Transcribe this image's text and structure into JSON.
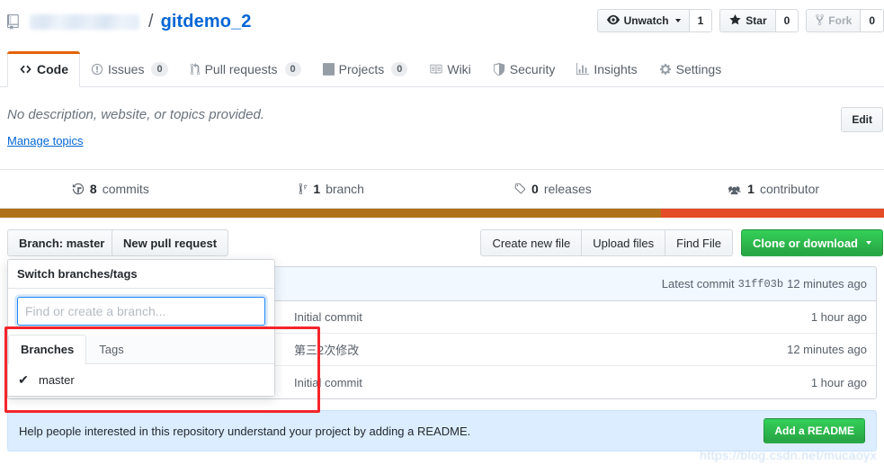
{
  "header": {
    "repo_icon": "repo-book-icon",
    "owner": "",
    "separator": "/",
    "repo_name": "gitdemo_2",
    "actions": [
      {
        "icon": "eye-icon",
        "label": "Unwatch",
        "count": "1",
        "has_caret": true,
        "disabled": false
      },
      {
        "icon": "star-icon",
        "label": "Star",
        "count": "0",
        "has_caret": false,
        "disabled": false
      },
      {
        "icon": "fork-icon",
        "label": "Fork",
        "count": "0",
        "has_caret": false,
        "disabled": true
      }
    ]
  },
  "nav": {
    "items": [
      {
        "icon": "code-icon",
        "label": "Code",
        "count": null,
        "selected": true
      },
      {
        "icon": "issue-opened-icon",
        "label": "Issues",
        "count": "0",
        "selected": false
      },
      {
        "icon": "git-pull-request-icon",
        "label": "Pull requests",
        "count": "0",
        "selected": false
      },
      {
        "icon": "project-board-icon",
        "label": "Projects",
        "count": "0",
        "selected": false
      },
      {
        "icon": "book-icon",
        "label": "Wiki",
        "count": null,
        "selected": false
      },
      {
        "icon": "shield-icon",
        "label": "Security",
        "count": null,
        "selected": false
      },
      {
        "icon": "graph-icon",
        "label": "Insights",
        "count": null,
        "selected": false
      },
      {
        "icon": "gear-icon",
        "label": "Settings",
        "count": null,
        "selected": false
      }
    ]
  },
  "about": {
    "description": "No description, website, or topics provided.",
    "manage_topics_label": "Manage topics",
    "edit_label": "Edit"
  },
  "stats": [
    {
      "icon": "history-icon",
      "value": "8",
      "label": "commits"
    },
    {
      "icon": "git-branch-icon",
      "value": "1",
      "label": "branch"
    },
    {
      "icon": "tag-icon",
      "value": "0",
      "label": "releases"
    },
    {
      "icon": "people-icon",
      "value": "1",
      "label": "contributor"
    }
  ],
  "language_bar": [
    {
      "color": "#b07219",
      "percent": 74.8
    },
    {
      "color": "#e34c26",
      "percent": 25.2
    }
  ],
  "toolbar": {
    "branch_button_label": "Branch: master",
    "new_pull_request_label": "New pull request",
    "create_new_file_label": "Create new file",
    "upload_files_label": "Upload files",
    "find_file_label": "Find File",
    "clone_label": "Clone or download"
  },
  "branch_dropdown": {
    "header": "Switch branches/tags",
    "search_placeholder": "Find or create a branch...",
    "search_value": "",
    "tabs": [
      {
        "label": "Branches",
        "active": true
      },
      {
        "label": "Tags",
        "active": false
      }
    ],
    "items": [
      {
        "label": "master",
        "selected": true,
        "check": "✔"
      }
    ]
  },
  "files": {
    "commit_bar": {
      "latest_commit_label": "Latest commit",
      "sha": "31ff03b",
      "age": "12 minutes ago"
    },
    "rows": [
      {
        "icon": "file-icon",
        "name": "",
        "message": "Initial commit",
        "age": "1 hour ago"
      },
      {
        "icon": "file-icon",
        "name": "",
        "message": "第三2次修改",
        "age": "12 minutes ago"
      },
      {
        "icon": "file-icon",
        "name": "",
        "message": "Initial commit",
        "age": "1 hour ago"
      }
    ]
  },
  "readme_banner": {
    "text": "Help people interested in this repository understand your project by adding a README.",
    "button_label": "Add a README"
  },
  "watermark": "https://blog.csdn.net/mucaoyx",
  "colors": {
    "accent_blue": "#0366d6",
    "tab_orange": "#e36209",
    "green_button": "#28a745",
    "annotation_red": "#f4252b",
    "focus_blue": "#2188ff",
    "banner_blue": "#dbedff"
  }
}
